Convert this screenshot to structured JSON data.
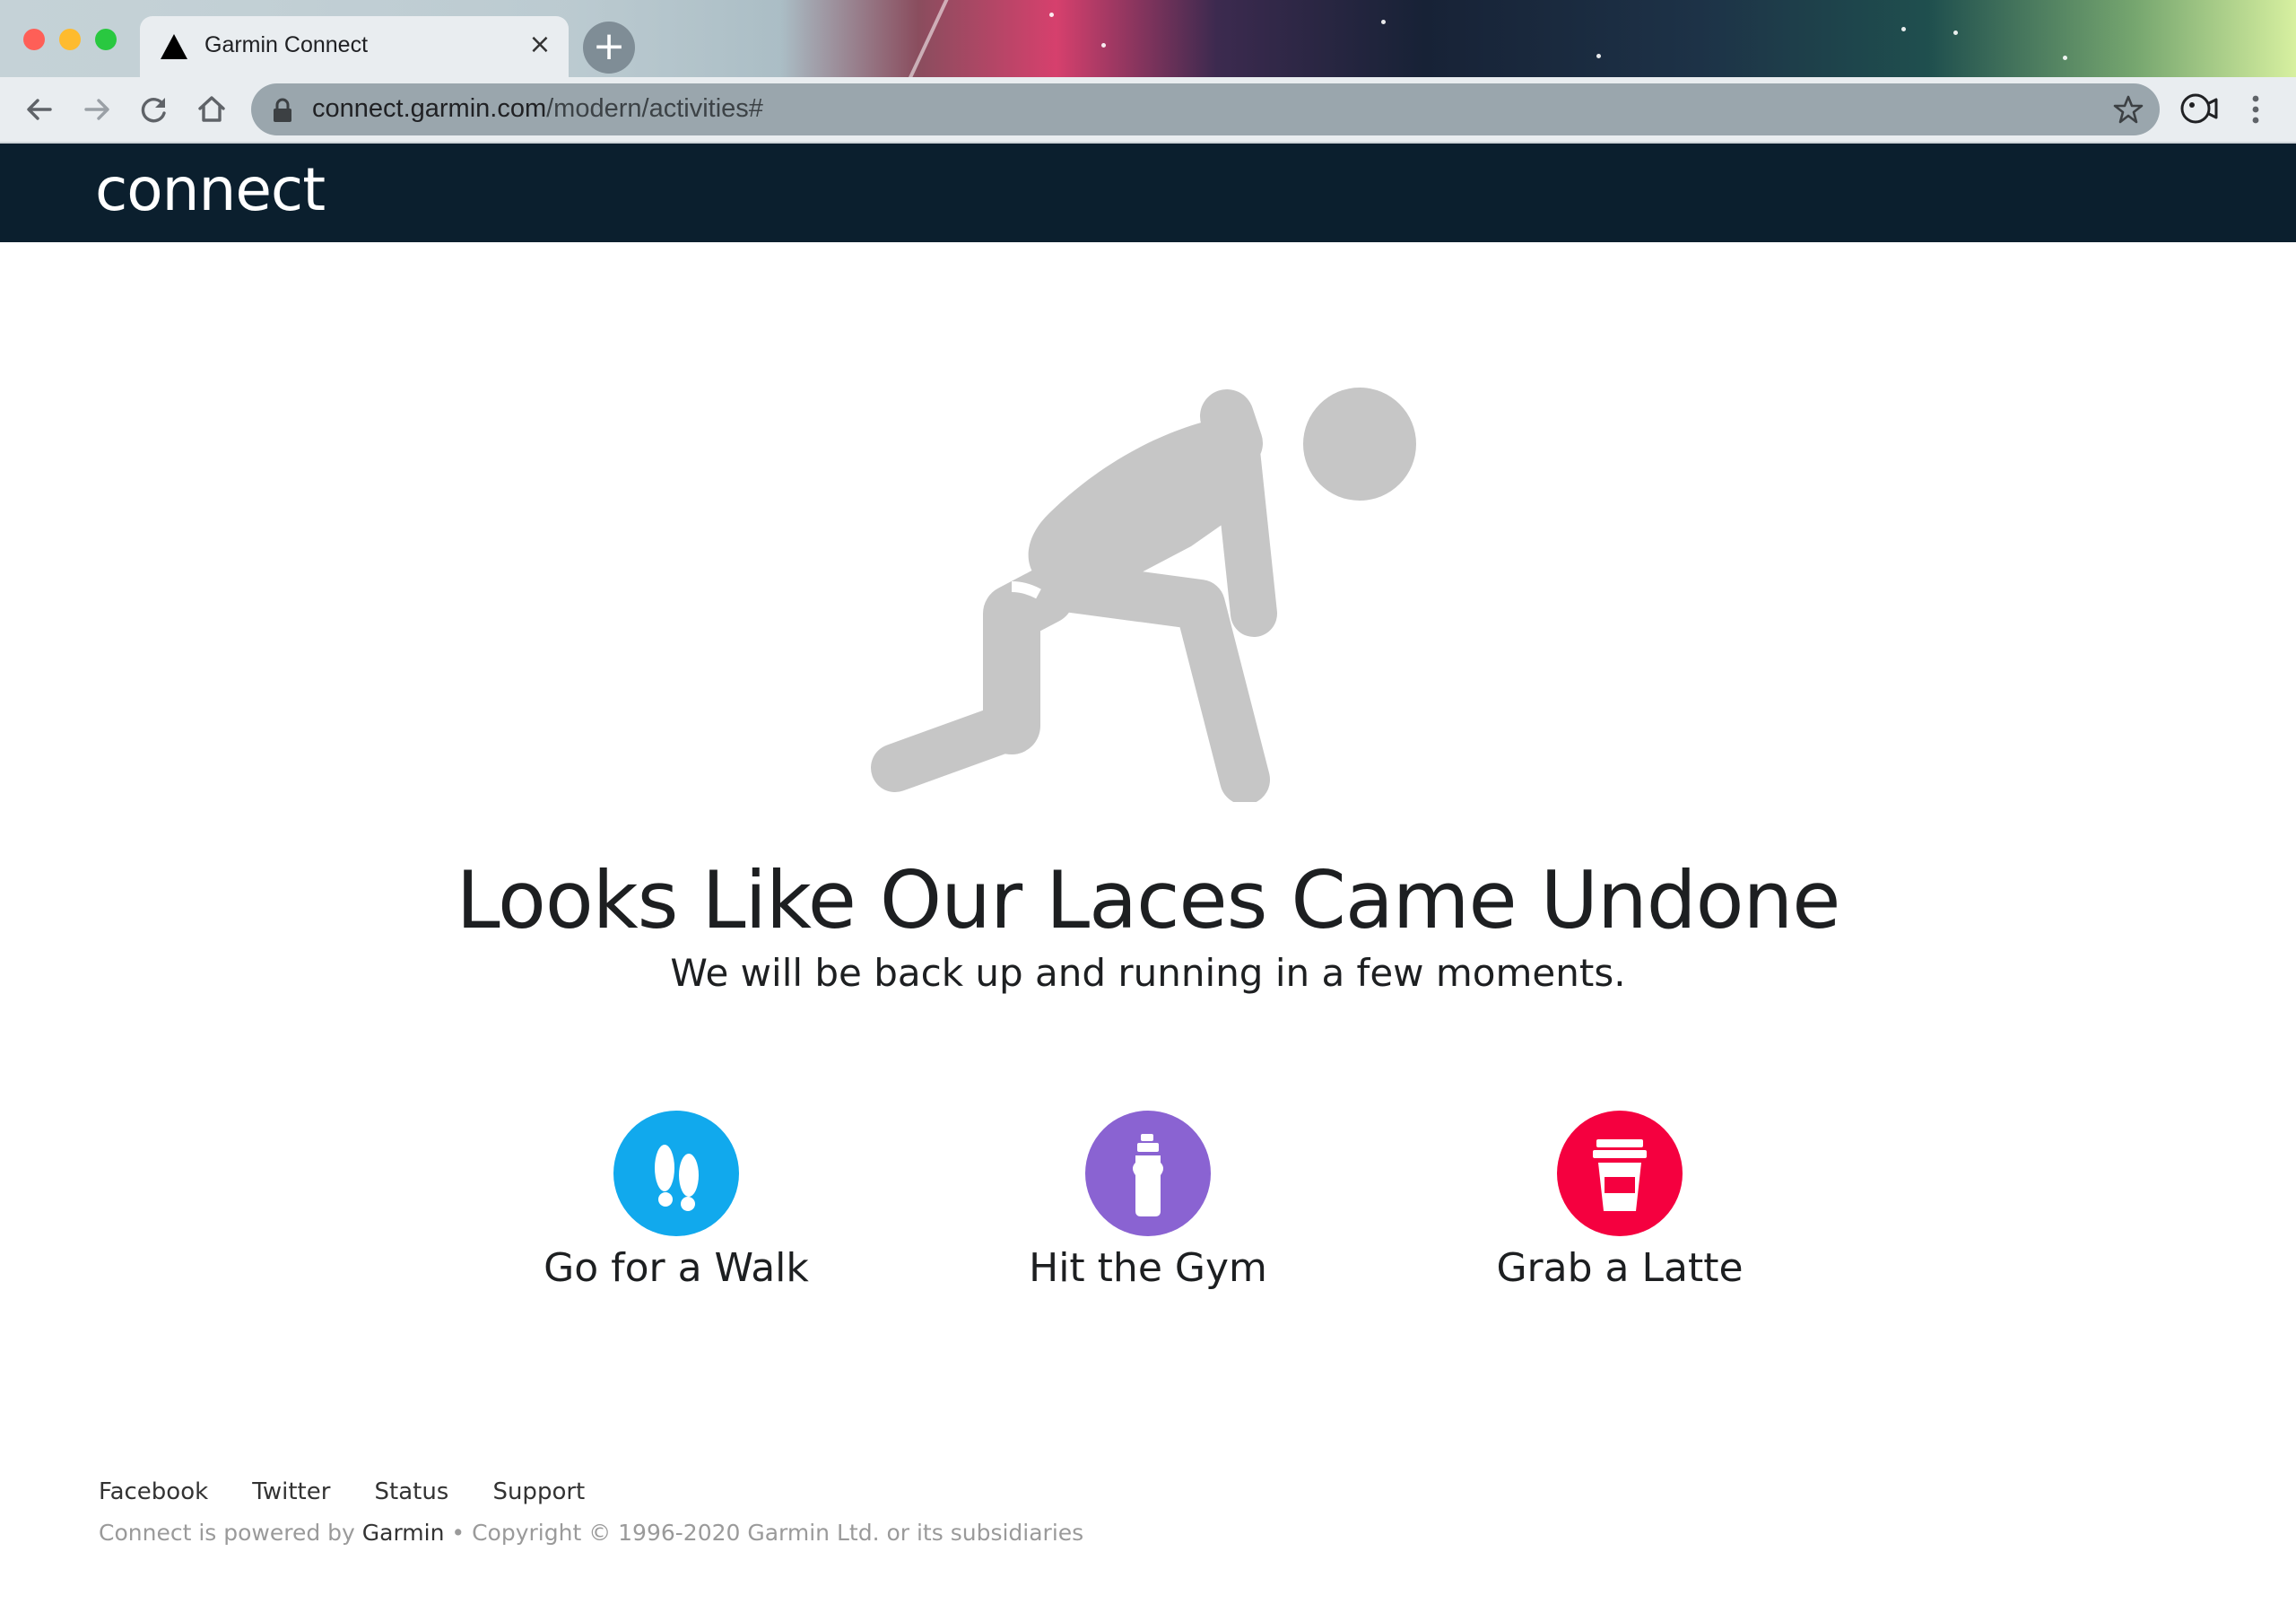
{
  "browser": {
    "tab_title": "Garmin Connect",
    "tab_close_glyph": "×",
    "new_tab_glyph": "+",
    "url_host": "connect.garmin.com",
    "url_path": "/modern/activities#",
    "icons": [
      "back-icon",
      "forward-icon",
      "reload-icon",
      "home-icon",
      "lock-icon",
      "bookmark-star-icon",
      "extension-icon",
      "menu-icon"
    ]
  },
  "site_header": {
    "logo_text": "connect",
    "background": "#0b1f2e"
  },
  "main": {
    "headline": "Looks Like Our Laces Came Undone",
    "subline": "We will be back up and running in a few moments.",
    "illustration_icon": "tying-shoe-person-icon",
    "actions": [
      {
        "label": "Go for a Walk",
        "icon": "footprints-icon",
        "color": "#11a9ed"
      },
      {
        "label": "Hit the Gym",
        "icon": "water-bottle-icon",
        "color": "#8a63d2"
      },
      {
        "label": "Grab a Latte",
        "icon": "coffee-cup-icon",
        "color": "#f5003f"
      }
    ]
  },
  "footer": {
    "links": [
      "Facebook",
      "Twitter",
      "Status",
      "Support"
    ],
    "powered_prefix": "Connect is powered by ",
    "powered_brand": "Garmin",
    "copyright": " • Copyright © 1996-2020 Garmin Ltd. or its subsidiaries"
  }
}
